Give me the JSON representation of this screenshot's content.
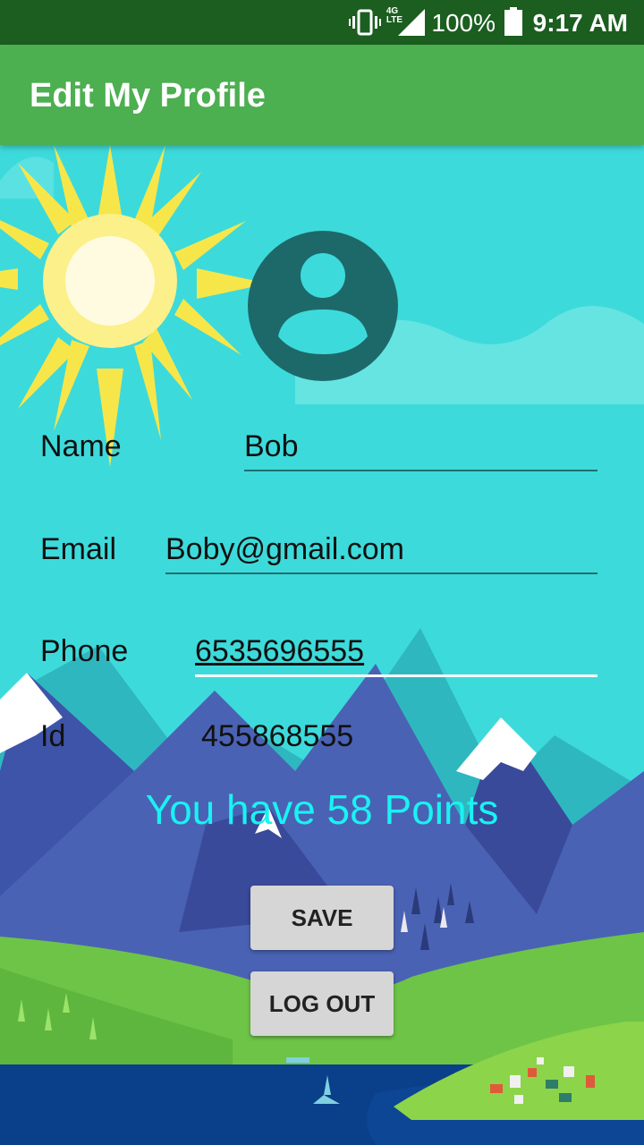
{
  "status_bar": {
    "network": "4G",
    "network_sub": "LTE",
    "battery": "100%",
    "time": "9:17 AM"
  },
  "app_bar": {
    "title": "Edit My Profile"
  },
  "profile": {
    "name_label": "Name",
    "name_value": "Bob",
    "email_label": "Email",
    "email_value": "Boby@gmail.com",
    "phone_label": "Phone",
    "phone_value": "6535696555",
    "id_label": "Id",
    "id_value": "455868555"
  },
  "points_text": "You have 58 Points",
  "buttons": {
    "save": "SAVE",
    "logout": "LOG OUT"
  },
  "colors": {
    "status_bar": "#1b5e20",
    "app_bar": "#4caf50",
    "sky": "#3ddadb",
    "points_text": "#19f2f2"
  }
}
